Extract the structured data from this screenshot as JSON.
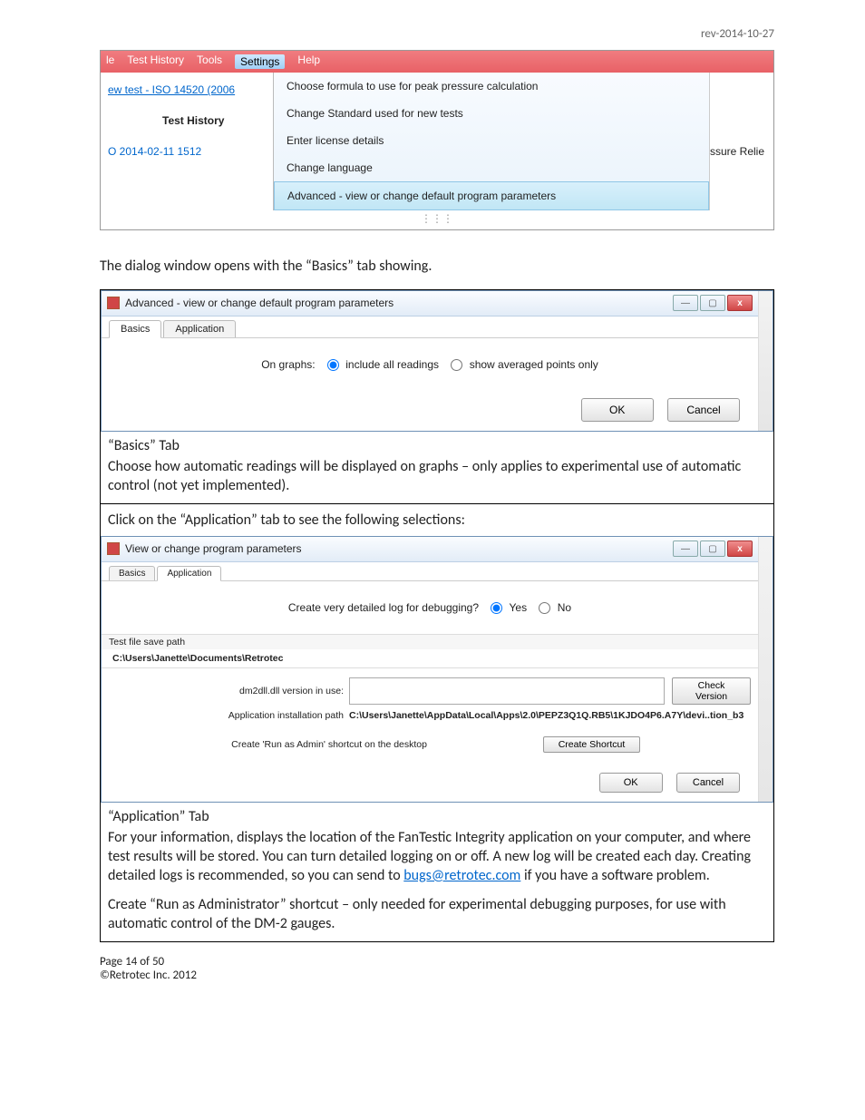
{
  "rev": "rev-2014-10-27",
  "menushot": {
    "menubar": [
      "le",
      "Test History",
      "Tools",
      "Settings",
      "Help"
    ],
    "active_menu": "Settings",
    "left": {
      "link1": "ew test - ISO 14520 (2006",
      "hdr": "Test History",
      "link2": "O 2014-02-11 1512",
      "cut": ""
    },
    "items": [
      "Choose formula to use for peak pressure calculation",
      "Change Standard used for new tests",
      "Enter license details",
      "Change language",
      "Advanced - view or change default program parameters"
    ],
    "overflow": "ssure Relie"
  },
  "p1": "The dialog window opens with the “Basics” tab showing.",
  "dlg_basics": {
    "title": "Advanced - view or change default program parameters",
    "tabs": [
      "Basics",
      "Application"
    ],
    "active_tab": "Basics",
    "radio_label": "On graphs:",
    "radio_opts": [
      "include all readings",
      "show averaged points only"
    ],
    "ok": "OK",
    "cancel": "Cancel"
  },
  "caption_basics": "“Basics” Tab",
  "desc_basics": "Choose how automatic readings will be displayed on graphs – only applies to experimental use of automatic control (not yet implemented).",
  "desc_click_app": "Click on the “Application” tab to see the following selections:",
  "dlg_app": {
    "title": "View or change program parameters",
    "tabs": [
      "Basics",
      "Application"
    ],
    "active_tab": "Application",
    "q1": "Create very detailed log for debugging?",
    "yes": "Yes",
    "no": "No",
    "savepath_lbl": "Test file save path",
    "savepath_val": "C:\\Users\\Janette\\Documents\\Retrotec",
    "dll_lbl": "dm2dll.dll version in use:",
    "dll_val": "",
    "check_btn": "Check Version",
    "inst_lbl": "Application installation path",
    "inst_val": "C:\\Users\\Janette\\AppData\\Local\\Apps\\2.0\\PEPZ3Q1Q.RB5\\1KJDO4P6.A7Y\\devi..tion_b3",
    "run_lbl": "Create 'Run as Admin' shortcut on the desktop",
    "run_btn": "Create Shortcut",
    "ok": "OK",
    "cancel": "Cancel"
  },
  "caption_app": "“Application” Tab",
  "para_app1a": "For your information, displays the location of the FanTestic Integrity application on your computer, and where test results will be stored.  You can turn detailed logging on or off.  A new log will be created each day.  Creating detailed logs is recommended, so you can send to ",
  "para_app1_mail": "bugs@retrotec.com",
  "para_app1b": " if you have a software problem.",
  "para_app2": "Create “Run as Administrator” shortcut – only needed for experimental debugging purposes, for use with automatic control of the DM-2 gauges.",
  "footer1": "Page 14 of 50",
  "footer2": "©Retrotec Inc. 2012"
}
